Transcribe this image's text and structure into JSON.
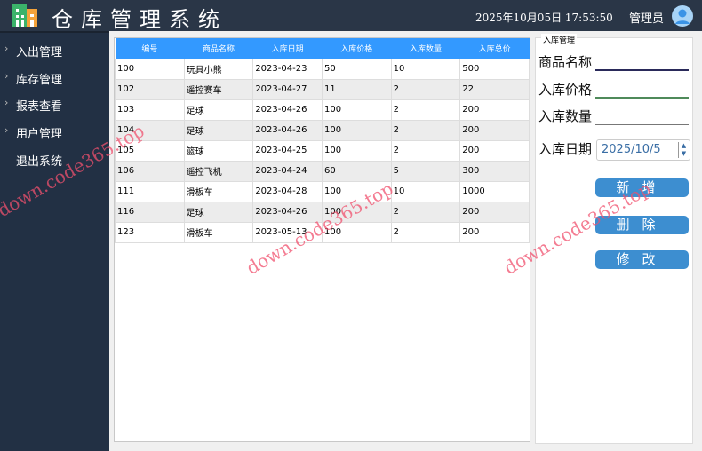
{
  "header": {
    "title": "仓库管理系统",
    "datetime": "2025年10月05日  17:53:50",
    "user": "管理员"
  },
  "sidebar": {
    "items": [
      {
        "label": "入出管理",
        "chevron": true
      },
      {
        "label": "库存管理",
        "chevron": true
      },
      {
        "label": "报表查看",
        "chevron": true
      },
      {
        "label": "用户管理",
        "chevron": true
      },
      {
        "label": "退出系统",
        "chevron": false
      }
    ]
  },
  "table": {
    "columns": [
      "编号",
      "商品名称",
      "入库日期",
      "入库价格",
      "入库数量",
      "入库总价"
    ],
    "rows": [
      [
        "100",
        "玩具小熊",
        "2023-04-23",
        "50",
        "10",
        "500"
      ],
      [
        "102",
        "遥控赛车",
        "2023-04-27",
        "11",
        "2",
        "22"
      ],
      [
        "103",
        "足球",
        "2023-04-26",
        "100",
        "2",
        "200"
      ],
      [
        "104",
        "足球",
        "2023-04-26",
        "100",
        "2",
        "200"
      ],
      [
        "105",
        "篮球",
        "2023-04-25",
        "100",
        "2",
        "200"
      ],
      [
        "106",
        "遥控飞机",
        "2023-04-24",
        "60",
        "5",
        "300"
      ],
      [
        "111",
        "滑板车",
        "2023-04-28",
        "100",
        "10",
        "1000"
      ],
      [
        "116",
        "足球",
        "2023-04-26",
        "100",
        "2",
        "200"
      ],
      [
        "123",
        "滑板车",
        "2023-05-13",
        "100",
        "2",
        "200"
      ]
    ]
  },
  "form": {
    "group_title": "入库管理",
    "name_label": "商品名称",
    "price_label": "入库价格",
    "qty_label": "入库数量",
    "date_label": "入库日期",
    "date_value": "2025/10/5",
    "add": "新增",
    "delete": "删除",
    "edit": "修改"
  },
  "watermark": "down.code365.top"
}
